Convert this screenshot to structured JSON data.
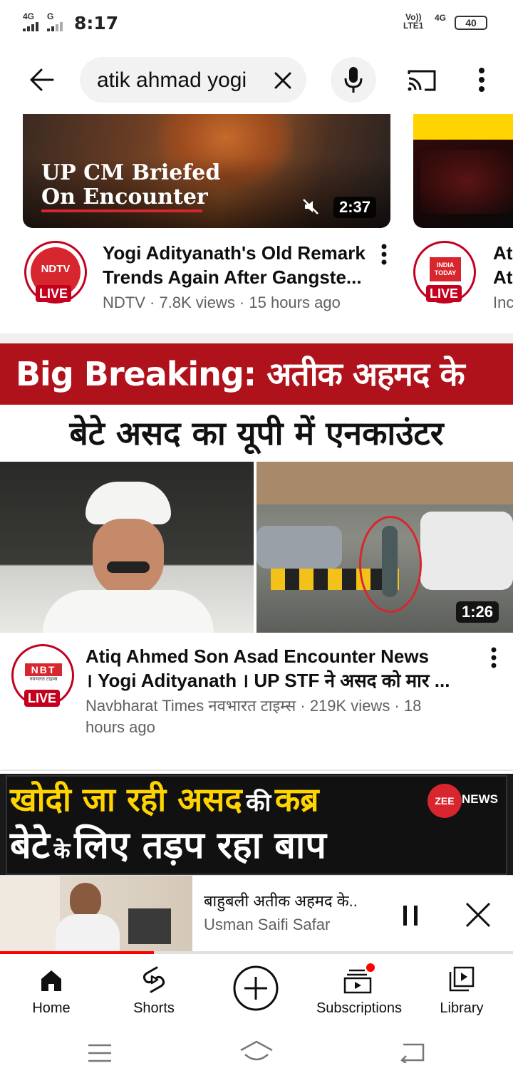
{
  "status_bar": {
    "signal_1": "4G",
    "signal_2": "G",
    "time": "8:17",
    "volte": "Vo))",
    "lte": "LTE1",
    "network": "4G",
    "battery": "40"
  },
  "search": {
    "query": "atik ahmad yogi"
  },
  "icons": {
    "back": "back-arrow-icon",
    "clear": "close-icon",
    "mic": "mic-icon",
    "cast": "cast-icon",
    "more": "more-vert-icon"
  },
  "videos": [
    {
      "thumbnail_text_line1": "UP CM Briefed",
      "thumbnail_text_line2": "On Encounter",
      "duration": "2:37",
      "title_line1": "Yogi Adityanath's Old Remark",
      "title_line2": "Trends Again After Gangste...",
      "channel_logo": "NDTV",
      "live_badge": "LIVE",
      "subtitle": "NDTV · 7.8K views · 15 hours ago"
    },
    {
      "title_line1": "At",
      "title_line2": "At",
      "channel_logo_line1": "INDIA",
      "channel_logo_line2": "TODAY",
      "live_badge": "LIVE",
      "subtitle": "Inc"
    },
    {
      "thumbnail_text_line1": "Big Breaking: अतीक अहमद के",
      "thumbnail_text_line2": "बेटे असद का यूपी में एनकाउंटर",
      "duration": "1:26",
      "title_line1": "Atiq Ahmed Son Asad Encounter News",
      "title_line2": "। Yogi Adityanath । UP STF ने असद को मार ...",
      "channel_logo": "NBT",
      "channel_logo_sub": "नवभारत टाइम्स",
      "live_badge": "LIVE",
      "subtitle_line1": "Navbharat Times नवभारत टाइम्स · 219K views · 18",
      "subtitle_line2": "hours ago"
    },
    {
      "thumbnail_text_line1": "खोदी जा रही असद",
      "thumbnail_text_line1b": "की",
      "thumbnail_text_line1c": "कब्र",
      "thumbnail_text_line2": "बेटे",
      "thumbnail_text_line2b": "के",
      "thumbnail_text_line2c": "लिए तड़प रहा बाप",
      "news_logo": "ZEE",
      "news_logo_b": "NEWS"
    }
  ],
  "mini_player": {
    "title": "बाहुबली अतीक अहमद के..",
    "channel": "Usman Saifi Safar",
    "progress_pct": 30
  },
  "bottom_nav": [
    {
      "label": "Home",
      "icon": "home-icon"
    },
    {
      "label": "Shorts",
      "icon": "shorts-icon"
    },
    {
      "label": "",
      "icon": "create-icon"
    },
    {
      "label": "Subscriptions",
      "icon": "subscriptions-icon"
    },
    {
      "label": "Library",
      "icon": "library-icon"
    }
  ],
  "colors": {
    "live_red": "#c4001f",
    "breaking_red": "#b0121b",
    "zee_yellow": "#ffd400"
  }
}
